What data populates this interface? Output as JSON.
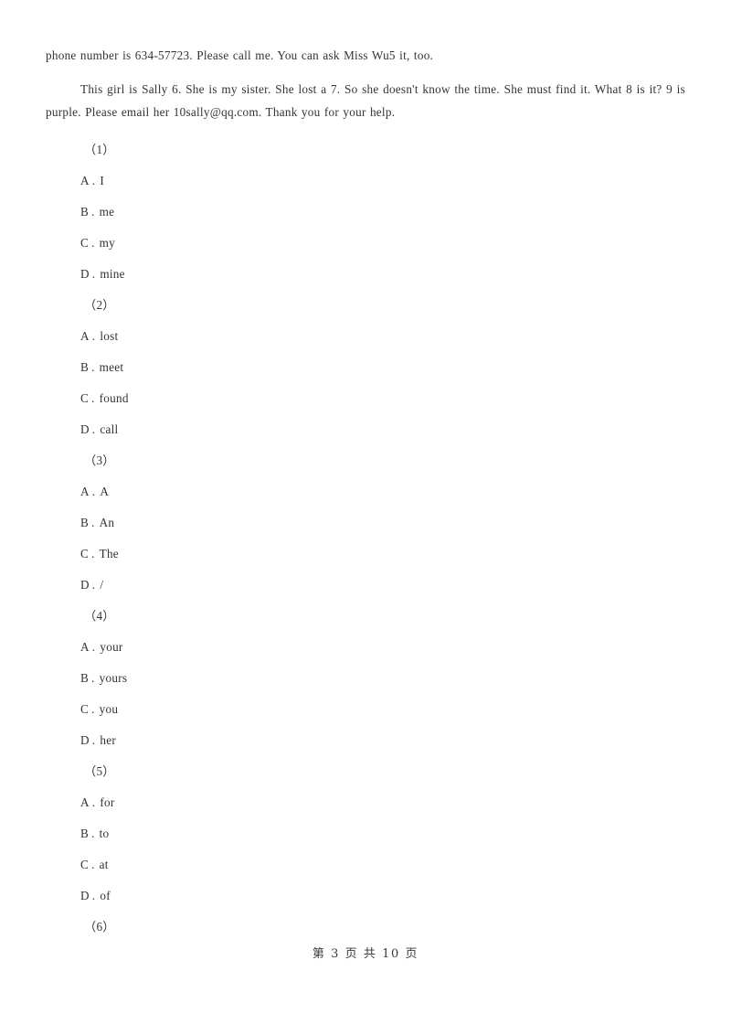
{
  "document": {
    "paragraphs": [
      {
        "id": "para-continued",
        "text": "phone number is 634-57723. Please call me. You can ask Miss Wu5 it, too."
      },
      {
        "id": "para-sally",
        "text": "This girl is Sally 6. She is my sister. She lost a 7. So she doesn't know the time. She must find it. What 8 is it? 9 is purple. Please email her 10sally@qq.com. Thank you for your help."
      }
    ],
    "questions": [
      {
        "number": "（1）",
        "options": [
          {
            "letter": "A",
            "dot": ".",
            "text": "I"
          },
          {
            "letter": "B",
            "dot": ".",
            "text": "me"
          },
          {
            "letter": "C",
            "dot": ".",
            "text": "my"
          },
          {
            "letter": "D",
            "dot": ".",
            "text": "mine"
          }
        ]
      },
      {
        "number": "（2）",
        "options": [
          {
            "letter": "A",
            "dot": ".",
            "text": "lost"
          },
          {
            "letter": "B",
            "dot": ".",
            "text": "meet"
          },
          {
            "letter": "C",
            "dot": ".",
            "text": "found"
          },
          {
            "letter": "D",
            "dot": ".",
            "text": "call"
          }
        ]
      },
      {
        "number": "（3）",
        "options": [
          {
            "letter": "A",
            "dot": ".",
            "text": "A"
          },
          {
            "letter": "B",
            "dot": ".",
            "text": "An"
          },
          {
            "letter": "C",
            "dot": ".",
            "text": "The"
          },
          {
            "letter": "D",
            "dot": ".",
            "text": "/"
          }
        ]
      },
      {
        "number": "（4）",
        "options": [
          {
            "letter": "A",
            "dot": ".",
            "text": "your"
          },
          {
            "letter": "B",
            "dot": ".",
            "text": "yours"
          },
          {
            "letter": "C",
            "dot": ".",
            "text": "you"
          },
          {
            "letter": "D",
            "dot": ".",
            "text": "her"
          }
        ]
      },
      {
        "number": "（5）",
        "options": [
          {
            "letter": "A",
            "dot": ".",
            "text": "for"
          },
          {
            "letter": "B",
            "dot": ".",
            "text": "to"
          },
          {
            "letter": "C",
            "dot": ".",
            "text": "at"
          },
          {
            "letter": "D",
            "dot": ".",
            "text": "of"
          }
        ]
      },
      {
        "number": "（6）",
        "options": []
      }
    ],
    "footer": {
      "text": "第 3 页 共 10 页",
      "current_page": "3",
      "total_pages": "10"
    }
  }
}
